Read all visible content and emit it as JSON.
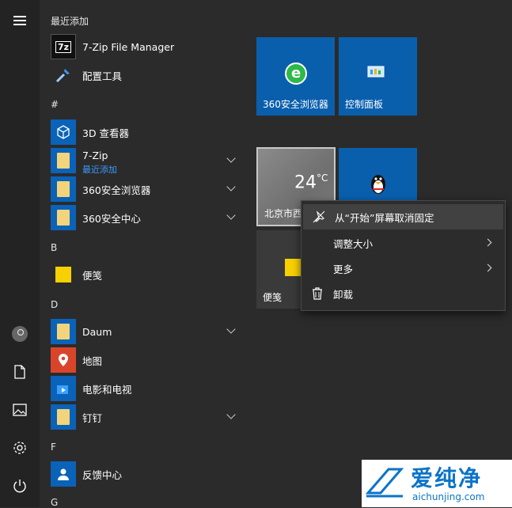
{
  "rail": {
    "icons": [
      "menu-icon",
      "user-icon",
      "document-icon",
      "pictures-icon",
      "settings-icon",
      "power-icon"
    ]
  },
  "list": {
    "recent_header": "最近添加",
    "items_recent": [
      {
        "label": "7-Zip File Manager"
      },
      {
        "label": "配置工具"
      }
    ],
    "hash_header": "#",
    "items_hash": [
      {
        "label": "3D 查看器"
      },
      {
        "label": "7-Zip",
        "sub": "最近添加"
      },
      {
        "label": "360安全浏览器"
      },
      {
        "label": "360安全中心"
      }
    ],
    "b_header": "B",
    "items_b": [
      {
        "label": "便笺"
      }
    ],
    "d_header": "D",
    "items_d": [
      {
        "label": "Daum"
      },
      {
        "label": "地图"
      },
      {
        "label": "电影和电视"
      },
      {
        "label": "钉钉"
      }
    ],
    "f_header": "F",
    "items_f": [
      {
        "label": "反馈中心"
      }
    ],
    "g_header": "G"
  },
  "tiles": {
    "browser": "360安全浏览器",
    "control_panel": "控制面板",
    "weather_temp": "24",
    "weather_unit": "°C",
    "weather_city": "北京市西",
    "memo": "便笺"
  },
  "context_menu": {
    "items": [
      "从“开始”屏幕取消固定",
      "调整大小",
      "更多",
      "卸载"
    ]
  },
  "watermark": {
    "text": "爱纯净",
    "url": "aichunjing.com"
  },
  "colors": {
    "tile_blue": "#0a5fad",
    "accent_link": "#3a9bff",
    "background": "#2b2b2b"
  }
}
